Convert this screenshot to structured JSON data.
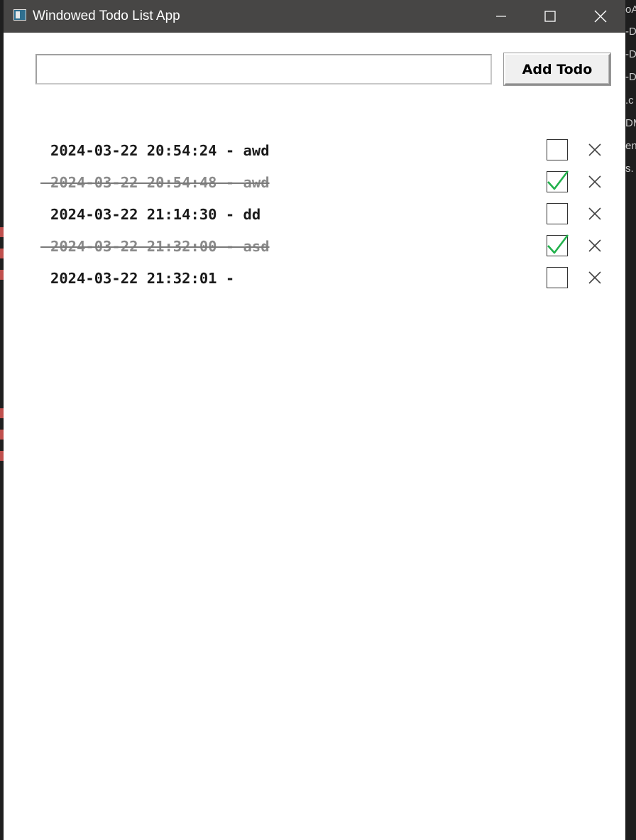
{
  "window": {
    "title": "Windowed Todo List App"
  },
  "input": {
    "value": "",
    "placeholder": ""
  },
  "toolbar": {
    "add_label": "Add Todo"
  },
  "todos": [
    {
      "text": "2024-03-22 20:54:24 - awd",
      "done": false
    },
    {
      "text": "2024-03-22 20:54:48 - awd",
      "done": true
    },
    {
      "text": "2024-03-22 21:14:30 - dd",
      "done": false
    },
    {
      "text": "2024-03-22 21:32:00 - asd",
      "done": true
    },
    {
      "text": "2024-03-22 21:32:01 -",
      "done": false
    }
  ],
  "background_fragments": [
    "oA",
    "-D",
    "-D",
    "-D",
    ".c",
    "DM",
    "en",
    "s."
  ],
  "colors": {
    "titlebar": "#474645",
    "check_mark": "#22b14c",
    "done_text": "#8a8a8a"
  }
}
